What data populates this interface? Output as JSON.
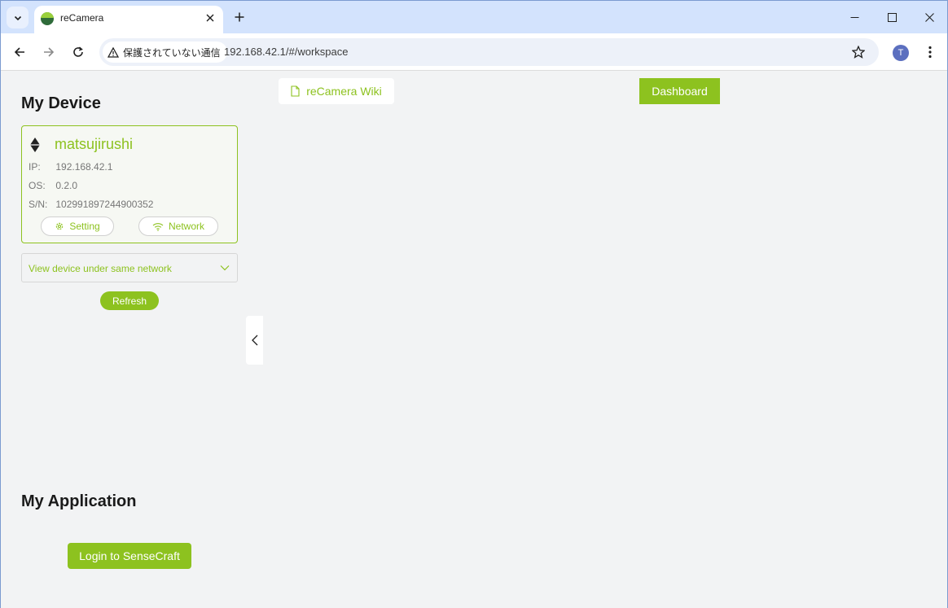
{
  "browser": {
    "tab_title": "reCamera",
    "security_label": "保護されていない通信",
    "url": "192.168.42.1/#/workspace",
    "profile_initial": "T"
  },
  "header": {
    "wiki_label": "reCamera Wiki",
    "dashboard_label": "Dashboard"
  },
  "device_section": {
    "title": "My Device",
    "device": {
      "name": "matsujirushi",
      "ip_label": "IP:",
      "ip": "192.168.42.1",
      "os_label": "OS:",
      "os": "0.2.0",
      "sn_label": "S/N:",
      "sn": "102991897244900352"
    },
    "setting_label": "Setting",
    "network_label": "Network",
    "select_value": "View device under same network",
    "refresh_label": "Refresh"
  },
  "app_section": {
    "title": "My Application",
    "login_label": "Login to SenseCraft"
  },
  "colors": {
    "accent": "#8dc21f",
    "chrome": "#d3e3fd"
  },
  "icons": [
    "chevron-down-icon",
    "close-icon",
    "plus-icon",
    "minimize-icon",
    "maximize-icon",
    "back-arrow-icon",
    "forward-arrow-icon",
    "reload-icon",
    "warning-icon",
    "star-icon",
    "kebab-menu-icon",
    "device-diamond-icon",
    "gear-icon",
    "wifi-icon",
    "document-icon",
    "chevron-left-icon"
  ]
}
